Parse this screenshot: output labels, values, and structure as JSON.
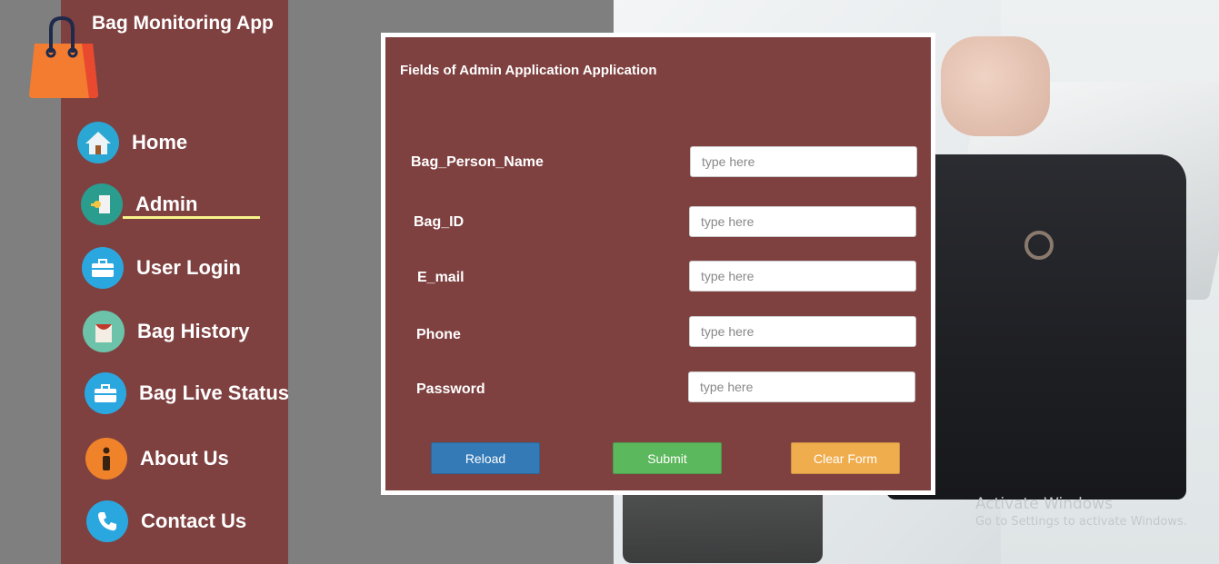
{
  "app": {
    "title": "Bag Monitoring App"
  },
  "nav": [
    {
      "label": "Home",
      "icon": "home-icon",
      "color": "#2aa7d3"
    },
    {
      "label": "Admin",
      "icon": "admin-key-icon",
      "color": "#2a9d8f"
    },
    {
      "label": "User Login",
      "icon": "briefcase-icon",
      "color": "#2ba7df"
    },
    {
      "label": "Bag History",
      "icon": "bag-history-icon",
      "color": "#6cc3a9"
    },
    {
      "label": "Bag Live Status",
      "icon": "briefcase-icon",
      "color": "#2ba7df"
    },
    {
      "label": "About Us",
      "icon": "info-icon",
      "color": "#f0832a"
    },
    {
      "label": "Contact Us",
      "icon": "phone-icon",
      "color": "#2ba7df"
    }
  ],
  "form": {
    "title": "Fields of Admin Application Application",
    "fields": [
      {
        "label": "Bag_Person_Name",
        "placeholder": "type here"
      },
      {
        "label": "Bag_ID",
        "placeholder": "type here"
      },
      {
        "label": "E_mail",
        "placeholder": "type here"
      },
      {
        "label": "Phone",
        "placeholder": "type here"
      },
      {
        "label": "Password",
        "placeholder": "type here"
      }
    ],
    "buttons": {
      "reload": "Reload",
      "submit": "Submit",
      "clear": "Clear Form"
    }
  },
  "colors": {
    "sidebar": "#7f4040",
    "reload": "#337ab7",
    "submit": "#5cb85c",
    "clear": "#f0ad4e",
    "underline": "#f6f48a"
  },
  "watermark": {
    "line1": "Activate Windows",
    "line2": "Go to Settings to activate Windows."
  }
}
